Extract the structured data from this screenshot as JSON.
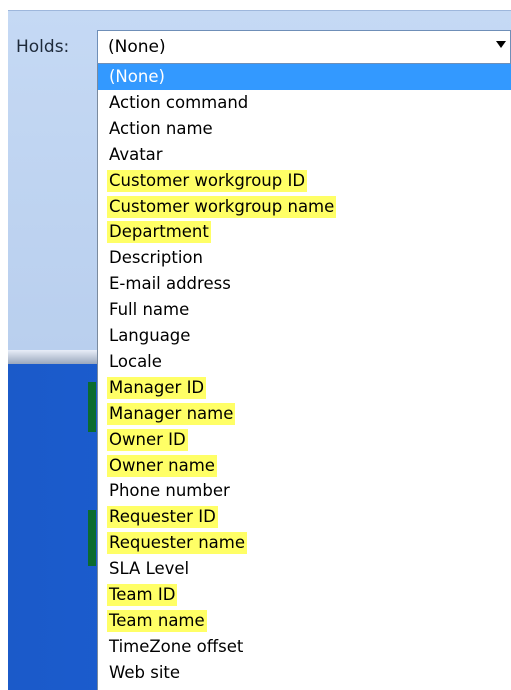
{
  "holds": {
    "label": "Holds:",
    "selected_value": "(None)",
    "options": [
      {
        "label": "(None)",
        "selected": true,
        "highlighted": false
      },
      {
        "label": "Action command",
        "selected": false,
        "highlighted": false
      },
      {
        "label": "Action name",
        "selected": false,
        "highlighted": false
      },
      {
        "label": "Avatar",
        "selected": false,
        "highlighted": false
      },
      {
        "label": "Customer workgroup ID",
        "selected": false,
        "highlighted": true
      },
      {
        "label": "Customer workgroup name",
        "selected": false,
        "highlighted": true
      },
      {
        "label": "Department",
        "selected": false,
        "highlighted": true
      },
      {
        "label": "Description",
        "selected": false,
        "highlighted": false
      },
      {
        "label": "E-mail address",
        "selected": false,
        "highlighted": false
      },
      {
        "label": "Full name",
        "selected": false,
        "highlighted": false
      },
      {
        "label": "Language",
        "selected": false,
        "highlighted": false
      },
      {
        "label": "Locale",
        "selected": false,
        "highlighted": false
      },
      {
        "label": "Manager ID",
        "selected": false,
        "highlighted": true
      },
      {
        "label": "Manager name",
        "selected": false,
        "highlighted": true
      },
      {
        "label": "Owner ID",
        "selected": false,
        "highlighted": true
      },
      {
        "label": "Owner name",
        "selected": false,
        "highlighted": true
      },
      {
        "label": "Phone number",
        "selected": false,
        "highlighted": false
      },
      {
        "label": "Requester ID",
        "selected": false,
        "highlighted": true
      },
      {
        "label": "Requester name",
        "selected": false,
        "highlighted": true
      },
      {
        "label": "SLA Level",
        "selected": false,
        "highlighted": false
      },
      {
        "label": "Team ID",
        "selected": false,
        "highlighted": true
      },
      {
        "label": "Team name",
        "selected": false,
        "highlighted": true
      },
      {
        "label": "TimeZone offset",
        "selected": false,
        "highlighted": false
      },
      {
        "label": "Web site",
        "selected": false,
        "highlighted": false
      }
    ]
  },
  "colors": {
    "selection": "#3399ff",
    "highlight": "#ffff66",
    "panel": "#c5d9f4",
    "background_blue": "#1a5fd6"
  },
  "icons": {
    "combo_arrow": "chevron-down-icon"
  }
}
